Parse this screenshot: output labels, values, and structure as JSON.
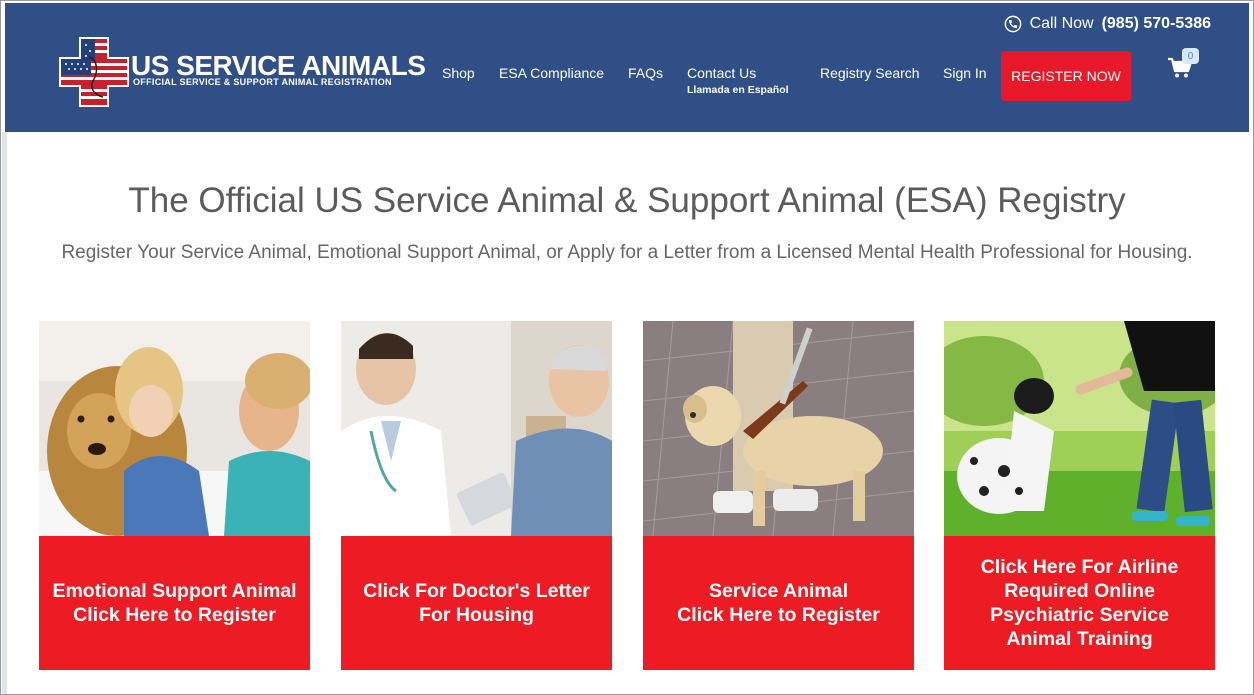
{
  "header": {
    "logo_main": "US SERVICE ANIMALS",
    "logo_sub": "OFFICIAL SERVICE & SUPPORT ANIMAL REGISTRATION",
    "call_label": "Call Now",
    "phone": "(985) 570-5386",
    "icons": {
      "phone": "phone-icon",
      "cart": "cart-icon"
    }
  },
  "nav": {
    "items": [
      {
        "label": "Shop"
      },
      {
        "label": "ESA Compliance"
      },
      {
        "label": "FAQs"
      },
      {
        "label": "Contact Us",
        "sub": "Llamada en Español"
      },
      {
        "label": "Registry Search"
      },
      {
        "label": "Sign In"
      }
    ],
    "register": "REGISTER NOW",
    "cart_count": "0"
  },
  "main": {
    "title": "The Official US Service Animal & Support Animal (ESA) Registry",
    "subtitle": "Register Your Service Animal, Emotional Support Animal, or Apply for a Letter from a Licensed Mental Health Professional for Housing.",
    "cards": [
      {
        "label": "Emotional Support Animal\nClick Here to Register"
      },
      {
        "label": "Click For Doctor's Letter\nFor Housing"
      },
      {
        "label": "Service Animal\nClick Here to Register"
      },
      {
        "label": "Click Here For Airline\nRequired Online\nPsychiatric Service\nAnimal Training"
      }
    ]
  },
  "colors": {
    "header_bg": "#2f4f86",
    "accent_red": "#ed1c24",
    "text_gray": "#5b5b5b"
  }
}
